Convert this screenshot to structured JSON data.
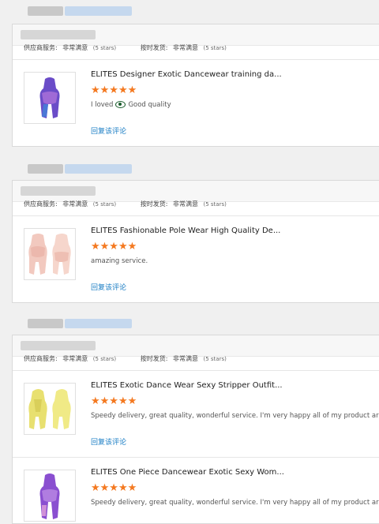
{
  "cards": [
    {
      "ratings": {
        "supplier_label": "供应商服务:",
        "supplier_value": "非常满意",
        "supplier_stars": "(5 stars)",
        "shipping_label": "按时发货:",
        "shipping_value": "非常满意",
        "shipping_stars": "(5 stars)"
      },
      "items": [
        {
          "title": "ELITES Designer Exotic Dancewear training da...",
          "stars": "★★★★★",
          "comment_a": "I loved",
          "comment_b": "Good quality",
          "reply": "回复该评论",
          "image_colors": [
            "#5b3fb8",
            "#9b5ed0",
            "#3e6fd1"
          ]
        }
      ]
    },
    {
      "ratings": {
        "supplier_label": "供应商服务:",
        "supplier_value": "非常满意",
        "supplier_stars": "(5 stars)",
        "shipping_label": "按时发货:",
        "shipping_value": "非常满意",
        "shipping_stars": "(5 stars)"
      },
      "items": [
        {
          "title": "ELITES Fashionable Pole Wear High Quality De...",
          "stars": "★★★★★",
          "comment": "amazing service.",
          "reply": "回复该评论",
          "image_colors": [
            "#f2c9bf",
            "#f6d6cc",
            "#e9b7ad"
          ]
        }
      ]
    },
    {
      "ratings": {
        "supplier_label": "供应商服务:",
        "supplier_value": "非常满意",
        "supplier_stars": "(5 stars)",
        "shipping_label": "按时发货:",
        "shipping_value": "非常满意",
        "shipping_stars": "(5 stars)"
      },
      "items": [
        {
          "title": "ELITES Exotic Dance Wear Sexy Stripper Outfit...",
          "stars": "★★★★★",
          "comment": "Speedy delivery, great quality, wonderful service. I'm very happy all of my product arrived.",
          "reply": "回复该评论",
          "image_colors": [
            "#e8e070",
            "#f0ea86",
            "#d9cf5a"
          ]
        },
        {
          "title": "ELITES One Piece Dancewear Exotic Sexy Wom...",
          "stars": "★★★★★",
          "comment": "Speedy delivery, great quality, wonderful service. I'm very happy all of my product arrived.",
          "image_colors": [
            "#8a4fd0",
            "#b07de0",
            "#d090d8"
          ]
        }
      ]
    }
  ],
  "colors": {
    "star": "#f47920",
    "link": "#1a7dc4",
    "blur_gray": "#c8c8c8",
    "blur_blue": "#c5d8ee"
  }
}
